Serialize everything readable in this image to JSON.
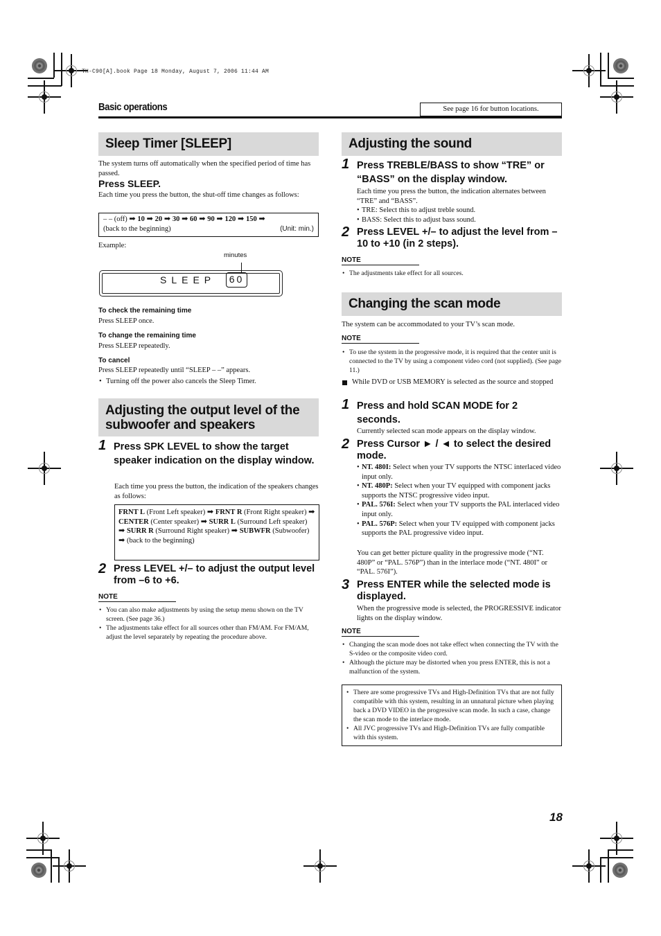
{
  "file_header": "TH-C90[A].book  Page 18  Monday, August 7, 2006  11:44 AM",
  "section_label": "Basic operations",
  "see_page_box": "See page 16 for button locations.",
  "page_number": "18",
  "sleep_timer": {
    "heading": "Sleep Timer [SLEEP]",
    "intro": "The system turns off automatically when the specified period of time has passed.",
    "press": "Press SLEEP.",
    "press_desc": "Each time you press the button, the shut-off time changes as follows:",
    "sequence_box": {
      "start": "– – (off)",
      "values": [
        "10",
        "20",
        "30",
        "60",
        "90",
        "120",
        "150"
      ],
      "arrow": "➡",
      "end": "(back to the beginning)",
      "unit": "(Unit: min.)"
    },
    "example_label": "Example:",
    "display": {
      "callout": "minutes",
      "text": "SLEEP",
      "value": "60"
    },
    "check": {
      "title": "To check the remaining time",
      "text": "Press SLEEP once."
    },
    "change": {
      "title": "To change the remaining time",
      "text": "Press SLEEP repeatedly."
    },
    "cancel": {
      "title": "To cancel",
      "text": "Press SLEEP repeatedly until “SLEEP – –” appears.",
      "bullet": "Turning off the power also cancels the Sleep Timer."
    }
  },
  "output_level": {
    "heading": "Adjusting the output level of the subwoofer and speakers",
    "step1": {
      "num": "1",
      "title": "Press SPK LEVEL to show the target speaker indication on the display window.",
      "desc": "Each time you press the button, the indication of the speakers changes as follows:"
    },
    "speaker_box": [
      {
        "code": "FRNT L",
        "desc": "(Front Left speaker)"
      },
      {
        "code": "FRNT R",
        "desc": "(Front Right speaker)"
      },
      {
        "code": "CENTER",
        "desc": "(Center speaker)"
      },
      {
        "code": "SURR L",
        "desc": "(Surround Left speaker)"
      },
      {
        "code": "SURR R",
        "desc": "(Surround Right speaker)"
      },
      {
        "code": "SUBWFR",
        "desc": "(Subwoofer)"
      }
    ],
    "speaker_box_end": "(back to the beginning)",
    "step2": {
      "num": "2",
      "title": "Press LEVEL +/– to adjust the output level from –6 to +6."
    },
    "note_title": "NOTE",
    "notes": [
      "You can also make adjustments by using the setup menu shown on the TV screen. (See page 36.)",
      "The adjustments take effect for all sources other than FM/AM. For FM/AM, adjust the level separately by repeating the procedure above."
    ]
  },
  "adjust_sound": {
    "heading": "Adjusting the sound",
    "step1": {
      "num": "1",
      "title": "Press TREBLE/BASS to show “TRE” or “BASS” on the display window.",
      "desc": "Each time you press the button, the indication alternates between “TRE” and “BASS”.",
      "bullets": [
        "TRE: Select this to adjust treble sound.",
        "BASS: Select this to adjust bass sound."
      ]
    },
    "step2": {
      "num": "2",
      "title": "Press LEVEL +/– to adjust the level from – 10 to +10 (in 2 steps)."
    },
    "note_title": "NOTE",
    "notes": [
      "The adjustments take effect for all sources."
    ]
  },
  "scan_mode": {
    "heading": "Changing the scan mode",
    "intro": "The system can be accommodated to your TV’s scan mode.",
    "note_title": "NOTE",
    "notes": [
      "To use the system in the progressive mode, it is required that the center unit is connected to the TV by using a component video cord (not supplied). (See page 11.)"
    ],
    "condition": "While DVD or USB MEMORY is selected as the source and stopped",
    "step1": {
      "num": "1",
      "title": "Press and hold SCAN MODE for 2 seconds.",
      "desc": "Currently selected scan mode appears on the display window."
    },
    "step2": {
      "num": "2",
      "title": "Press Cursor ► / ◄ to select the desired mode.",
      "modes": [
        {
          "name": "NT. 480I:",
          "desc": "Select when your TV supports the NTSC interlaced video input only."
        },
        {
          "name": "NT. 480P:",
          "desc": "Select when your TV equipped with component jacks supports the NTSC progressive video input."
        },
        {
          "name": "PAL. 576I:",
          "desc": "Select when your TV supports the PAL interlaced video input only."
        },
        {
          "name": "PAL. 576P:",
          "desc": "Select when your TV equipped with component jacks supports the PAL progressive video input."
        }
      ],
      "tip": "You can get better picture quality in the progressive mode (“NT. 480P” or “PAL. 576P”) than in the interlace mode (“NT. 480I” or “PAL. 576I”)."
    },
    "step3": {
      "num": "3",
      "title": "Press ENTER while the selected mode is displayed.",
      "desc": "When the progressive mode is selected, the PROGRESSIVE indicator lights on the display window."
    },
    "note2_title": "NOTE",
    "notes2": [
      "Changing the scan mode does not take effect when connecting the TV with the S-video or the composite video cord.",
      "Although the picture may be distorted when you press ENTER, this is not a malfunction of the system."
    ],
    "warning_box": [
      "There are some progressive TVs and High-Definition TVs that are not fully compatible with this system, resulting in an unnatural picture when playing back a DVD VIDEO in the progressive scan mode. In such a case, change the scan mode to the interlace mode.",
      "All JVC progressive TVs and High-Definition TVs are fully compatible with this system."
    ]
  }
}
